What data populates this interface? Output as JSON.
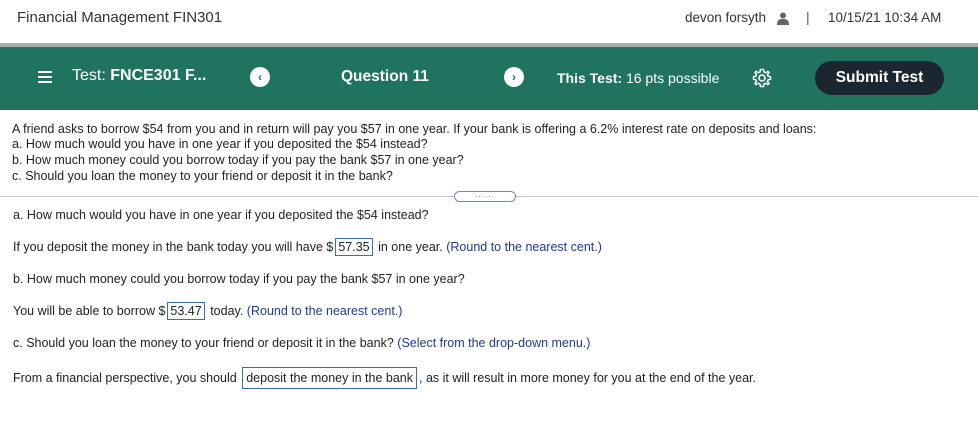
{
  "topbar": {
    "course": "Financial Management FIN301",
    "user": "devon forsyth",
    "separator": "|",
    "datetime": "10/15/21 10:34 AM"
  },
  "header": {
    "test_prefix": "Test:",
    "test_name": "FNCE301 F...",
    "prev_symbol": "‹",
    "next_symbol": "›",
    "question": "Question 11",
    "this_test_label": "This Test:",
    "this_test_value": "16 pts possible",
    "submit_label": "Submit Test"
  },
  "question": {
    "intro": "A friend asks to borrow $54 from you and in return will pay you $57 in one year. If your bank is offering a 6.2% interest rate on deposits and loans:",
    "a": "a. How much would you have in one year if you deposited the $54 instead?",
    "b": "b. How much money could you borrow today if you pay the bank $57 in one year?",
    "c": "c. Should you loan the money to your friend or deposit it in the bank?"
  },
  "divider_handle": "......",
  "answers": {
    "a_heading": "a. How much would you have in one year if you deposited the $54 instead?",
    "a_text_before": "If you deposit the money in the bank today you will have $",
    "a_value": "57.35",
    "a_text_after": "in one year.",
    "a_hint": "(Round to the nearest cent.)",
    "b_heading": "b. How much money could you borrow today if you pay the bank $57 in one year?",
    "b_text_before": "You will be able to borrow $",
    "b_value": "53.47",
    "b_text_after": "today.",
    "b_hint": "(Round to the nearest cent.)",
    "c_heading": "c. Should you loan the money to your friend or deposit it in the bank?",
    "c_hint": "(Select from the drop-down menu.)",
    "c_text_before": "From a financial perspective, you should",
    "c_value": "deposit the money in the bank",
    "c_text_after": ", as it will result in more money for you at the end of the year."
  },
  "colors": {
    "header_green": "#1f735f",
    "submit_dark": "#1b2631",
    "hint_blue": "#1f3a93",
    "box_border": "#3a6fb6"
  }
}
